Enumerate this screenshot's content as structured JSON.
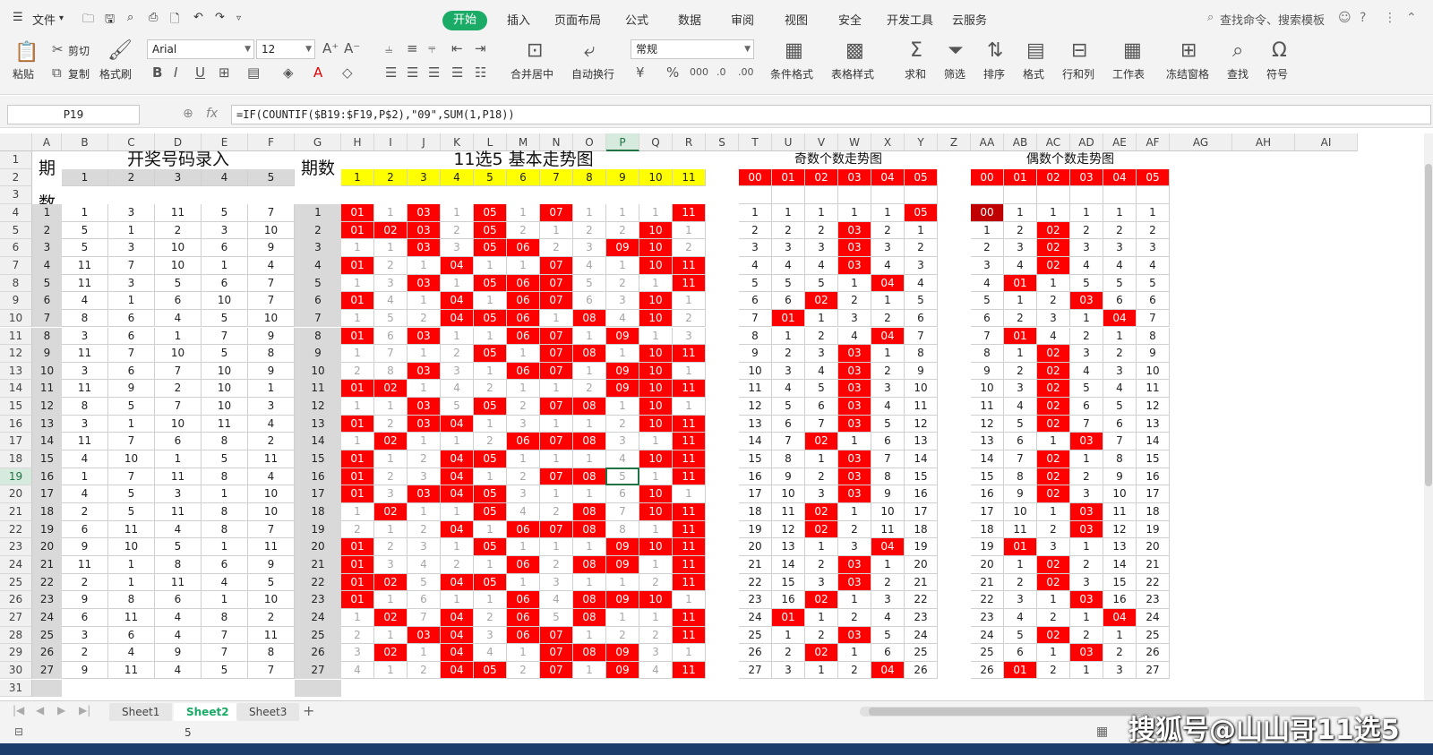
{
  "menu": {
    "file": "文件",
    "tabs": [
      "开始",
      "插入",
      "页面布局",
      "公式",
      "数据",
      "审阅",
      "视图",
      "安全",
      "开发工具",
      "云服务"
    ],
    "active_tab": "开始",
    "search": "查找命令、搜索模板"
  },
  "ribbon": {
    "paste": "粘贴",
    "cut": "剪切",
    "copy": "复制",
    "format_painter": "格式刷",
    "font_name": "Arial",
    "font_size": "12",
    "merge_center": "合并居中",
    "wrap": "自动换行",
    "number_format": "常规",
    "cond_format": "条件格式",
    "table_style": "表格样式",
    "sum": "求和",
    "filter": "筛选",
    "sort": "排序",
    "format": "格式",
    "rowcol": "行和列",
    "worksheet": "工作表",
    "freeze": "冻结窗格",
    "find": "查找",
    "symbol": "符号"
  },
  "formula_bar": {
    "cell_ref": "P19",
    "fx": "fx",
    "formula": "=IF(COUNTIF($B19:$F19,P$2),\"09\",SUM(1,P18))"
  },
  "columns": [
    "A",
    "B",
    "C",
    "D",
    "E",
    "F",
    "G",
    "H",
    "I",
    "J",
    "K",
    "L",
    "M",
    "N",
    "O",
    "P",
    "Q",
    "R",
    "S",
    "T",
    "U",
    "V",
    "W",
    "X",
    "Y",
    "Z",
    "AA",
    "AB",
    "AC",
    "AD",
    "AE",
    "AF",
    "AG",
    "AH",
    "AI"
  ],
  "selected_col": "P",
  "selected_row": 19,
  "rows": [
    1,
    2,
    3,
    4,
    5,
    6,
    7,
    8,
    9,
    10,
    11,
    12,
    13,
    14,
    15,
    16,
    17,
    18,
    19,
    20,
    21,
    22,
    23,
    24,
    25,
    26,
    27,
    28,
    29,
    30,
    31
  ],
  "headers": {
    "period": "期数",
    "entry": "开奖号码录入",
    "trend": "11选5  基本走势图",
    "odd": "奇数个数走势图",
    "even": "偶数个数走势图",
    "entry_cols": [
      "1",
      "2",
      "3",
      "4",
      "5"
    ],
    "trend_cols": [
      "1",
      "2",
      "3",
      "4",
      "5",
      "6",
      "7",
      "8",
      "9",
      "10",
      "11"
    ],
    "count_cols": [
      "00",
      "01",
      "02",
      "03",
      "04",
      "05"
    ]
  },
  "draws": [
    [
      1,
      3,
      11,
      5,
      7
    ],
    [
      5,
      1,
      2,
      3,
      10
    ],
    [
      5,
      3,
      10,
      6,
      9
    ],
    [
      11,
      7,
      10,
      1,
      4
    ],
    [
      11,
      3,
      5,
      6,
      7
    ],
    [
      4,
      1,
      6,
      10,
      7
    ],
    [
      8,
      6,
      4,
      5,
      10
    ],
    [
      3,
      6,
      1,
      7,
      9
    ],
    [
      11,
      7,
      10,
      5,
      8
    ],
    [
      3,
      6,
      7,
      10,
      9
    ],
    [
      11,
      9,
      2,
      10,
      1
    ],
    [
      8,
      5,
      7,
      10,
      3
    ],
    [
      3,
      1,
      10,
      11,
      4
    ],
    [
      11,
      7,
      6,
      8,
      2
    ],
    [
      4,
      10,
      1,
      5,
      11
    ],
    [
      1,
      7,
      11,
      8,
      4
    ],
    [
      4,
      5,
      3,
      1,
      10
    ],
    [
      2,
      5,
      11,
      8,
      10
    ],
    [
      6,
      11,
      4,
      8,
      7
    ],
    [
      9,
      10,
      5,
      1,
      11
    ],
    [
      11,
      1,
      8,
      6,
      9
    ],
    [
      2,
      1,
      11,
      4,
      5
    ],
    [
      9,
      8,
      6,
      1,
      10
    ],
    [
      6,
      11,
      4,
      8,
      2
    ],
    [
      3,
      6,
      4,
      7,
      11
    ],
    [
      2,
      4,
      9,
      7,
      8
    ],
    [
      9,
      11,
      4,
      5,
      7
    ]
  ],
  "trend": [
    [
      "01",
      "1",
      "03",
      "1",
      "05",
      "1",
      "07",
      "1",
      "1",
      "1",
      "11"
    ],
    [
      "01",
      "02",
      "03",
      "2",
      "05",
      "2",
      "1",
      "2",
      "2",
      "10",
      "1"
    ],
    [
      "1",
      "1",
      "03",
      "3",
      "05",
      "06",
      "2",
      "3",
      "09",
      "10",
      "2"
    ],
    [
      "01",
      "2",
      "1",
      "04",
      "1",
      "1",
      "07",
      "4",
      "1",
      "10",
      "11"
    ],
    [
      "1",
      "3",
      "03",
      "1",
      "05",
      "06",
      "07",
      "5",
      "2",
      "1",
      "11"
    ],
    [
      "01",
      "4",
      "1",
      "04",
      "1",
      "06",
      "07",
      "6",
      "3",
      "10",
      "1"
    ],
    [
      "1",
      "5",
      "2",
      "04",
      "05",
      "06",
      "1",
      "08",
      "4",
      "10",
      "2"
    ],
    [
      "01",
      "6",
      "03",
      "1",
      "1",
      "06",
      "07",
      "1",
      "09",
      "1",
      "3"
    ],
    [
      "1",
      "7",
      "1",
      "2",
      "05",
      "1",
      "07",
      "08",
      "1",
      "10",
      "11"
    ],
    [
      "2",
      "8",
      "03",
      "3",
      "1",
      "06",
      "07",
      "1",
      "09",
      "10",
      "1"
    ],
    [
      "01",
      "02",
      "1",
      "4",
      "2",
      "1",
      "1",
      "2",
      "09",
      "10",
      "11"
    ],
    [
      "1",
      "1",
      "03",
      "5",
      "05",
      "2",
      "07",
      "08",
      "1",
      "10",
      "1"
    ],
    [
      "01",
      "2",
      "03",
      "04",
      "1",
      "3",
      "1",
      "1",
      "2",
      "10",
      "11"
    ],
    [
      "1",
      "02",
      "1",
      "1",
      "2",
      "06",
      "07",
      "08",
      "3",
      "1",
      "11"
    ],
    [
      "01",
      "1",
      "2",
      "04",
      "05",
      "1",
      "1",
      "1",
      "4",
      "10",
      "11"
    ],
    [
      "01",
      "2",
      "3",
      "04",
      "1",
      "2",
      "07",
      "08",
      "5",
      "1",
      "11"
    ],
    [
      "01",
      "3",
      "03",
      "04",
      "05",
      "3",
      "1",
      "1",
      "6",
      "10",
      "1"
    ],
    [
      "1",
      "02",
      "1",
      "1",
      "05",
      "4",
      "2",
      "08",
      "7",
      "10",
      "11"
    ],
    [
      "2",
      "1",
      "2",
      "04",
      "1",
      "06",
      "07",
      "08",
      "8",
      "1",
      "11"
    ],
    [
      "01",
      "2",
      "3",
      "1",
      "05",
      "1",
      "1",
      "1",
      "09",
      "10",
      "11"
    ],
    [
      "01",
      "3",
      "4",
      "2",
      "1",
      "06",
      "2",
      "08",
      "09",
      "1",
      "11"
    ],
    [
      "01",
      "02",
      "5",
      "04",
      "05",
      "1",
      "3",
      "1",
      "1",
      "2",
      "11"
    ],
    [
      "01",
      "1",
      "6",
      "1",
      "1",
      "06",
      "4",
      "08",
      "09",
      "10",
      "1"
    ],
    [
      "1",
      "02",
      "7",
      "04",
      "2",
      "06",
      "5",
      "08",
      "1",
      "1",
      "11"
    ],
    [
      "2",
      "1",
      "03",
      "04",
      "3",
      "06",
      "07",
      "1",
      "2",
      "2",
      "11"
    ],
    [
      "3",
      "02",
      "1",
      "04",
      "4",
      "1",
      "07",
      "08",
      "09",
      "3",
      "1"
    ],
    [
      "4",
      "1",
      "2",
      "04",
      "05",
      "2",
      "07",
      "1",
      "09",
      "4",
      "11"
    ]
  ],
  "odd": [
    [
      "1",
      "1",
      "1",
      "1",
      "1",
      "05"
    ],
    [
      "2",
      "2",
      "2",
      "03",
      "2",
      "1"
    ],
    [
      "3",
      "3",
      "3",
      "03",
      "3",
      "2"
    ],
    [
      "4",
      "4",
      "4",
      "03",
      "4",
      "3"
    ],
    [
      "5",
      "5",
      "5",
      "1",
      "04",
      "4"
    ],
    [
      "6",
      "6",
      "02",
      "2",
      "1",
      "5"
    ],
    [
      "7",
      "01",
      "1",
      "3",
      "2",
      "6"
    ],
    [
      "8",
      "1",
      "2",
      "4",
      "04",
      "7"
    ],
    [
      "9",
      "2",
      "3",
      "03",
      "1",
      "8"
    ],
    [
      "10",
      "3",
      "4",
      "03",
      "2",
      "9"
    ],
    [
      "11",
      "4",
      "5",
      "03",
      "3",
      "10"
    ],
    [
      "12",
      "5",
      "6",
      "03",
      "4",
      "11"
    ],
    [
      "13",
      "6",
      "7",
      "03",
      "5",
      "12"
    ],
    [
      "14",
      "7",
      "02",
      "1",
      "6",
      "13"
    ],
    [
      "15",
      "8",
      "1",
      "03",
      "7",
      "14"
    ],
    [
      "16",
      "9",
      "2",
      "03",
      "8",
      "15"
    ],
    [
      "17",
      "10",
      "3",
      "03",
      "9",
      "16"
    ],
    [
      "18",
      "11",
      "02",
      "1",
      "10",
      "17"
    ],
    [
      "19",
      "12",
      "02",
      "2",
      "11",
      "18"
    ],
    [
      "20",
      "13",
      "1",
      "3",
      "04",
      "19"
    ],
    [
      "21",
      "14",
      "2",
      "03",
      "1",
      "20"
    ],
    [
      "22",
      "15",
      "3",
      "03",
      "2",
      "21"
    ],
    [
      "23",
      "16",
      "02",
      "1",
      "3",
      "22"
    ],
    [
      "24",
      "01",
      "1",
      "2",
      "4",
      "23"
    ],
    [
      "25",
      "1",
      "2",
      "03",
      "5",
      "24"
    ],
    [
      "26",
      "2",
      "02",
      "1",
      "6",
      "25"
    ],
    [
      "27",
      "3",
      "1",
      "2",
      "04",
      "26"
    ]
  ],
  "even": [
    [
      "00",
      "1",
      "1",
      "1",
      "1",
      "1"
    ],
    [
      "1",
      "2",
      "02",
      "2",
      "2",
      "2"
    ],
    [
      "2",
      "3",
      "02",
      "3",
      "3",
      "3"
    ],
    [
      "3",
      "4",
      "02",
      "4",
      "4",
      "4"
    ],
    [
      "4",
      "01",
      "1",
      "5",
      "5",
      "5"
    ],
    [
      "5",
      "1",
      "2",
      "03",
      "6",
      "6"
    ],
    [
      "6",
      "2",
      "3",
      "1",
      "04",
      "7"
    ],
    [
      "7",
      "01",
      "4",
      "2",
      "1",
      "8"
    ],
    [
      "8",
      "1",
      "02",
      "3",
      "2",
      "9"
    ],
    [
      "9",
      "2",
      "02",
      "4",
      "3",
      "10"
    ],
    [
      "10",
      "3",
      "02",
      "5",
      "4",
      "11"
    ],
    [
      "11",
      "4",
      "02",
      "6",
      "5",
      "12"
    ],
    [
      "12",
      "5",
      "02",
      "7",
      "6",
      "13"
    ],
    [
      "13",
      "6",
      "1",
      "03",
      "7",
      "14"
    ],
    [
      "14",
      "7",
      "02",
      "1",
      "8",
      "15"
    ],
    [
      "15",
      "8",
      "02",
      "2",
      "9",
      "16"
    ],
    [
      "16",
      "9",
      "02",
      "3",
      "10",
      "17"
    ],
    [
      "17",
      "10",
      "1",
      "03",
      "11",
      "18"
    ],
    [
      "18",
      "11",
      "2",
      "03",
      "12",
      "19"
    ],
    [
      "19",
      "01",
      "3",
      "1",
      "13",
      "20"
    ],
    [
      "20",
      "1",
      "02",
      "2",
      "14",
      "21"
    ],
    [
      "21",
      "2",
      "02",
      "3",
      "15",
      "22"
    ],
    [
      "22",
      "3",
      "1",
      "03",
      "16",
      "23"
    ],
    [
      "23",
      "4",
      "2",
      "1",
      "04",
      "24"
    ],
    [
      "24",
      "5",
      "02",
      "2",
      "1",
      "25"
    ],
    [
      "25",
      "6",
      "1",
      "03",
      "2",
      "26"
    ],
    [
      "26",
      "01",
      "2",
      "1",
      "3",
      "27"
    ]
  ],
  "sheets": [
    "Sheet1",
    "Sheet2",
    "Sheet3"
  ],
  "active_sheet": "Sheet2",
  "status": {
    "value": "5"
  },
  "watermark": "搜狐号@山山哥11选5",
  "colors": {
    "hit": "#ff0000",
    "accent": "#1aab66",
    "header_yellow": "#ffff00"
  }
}
